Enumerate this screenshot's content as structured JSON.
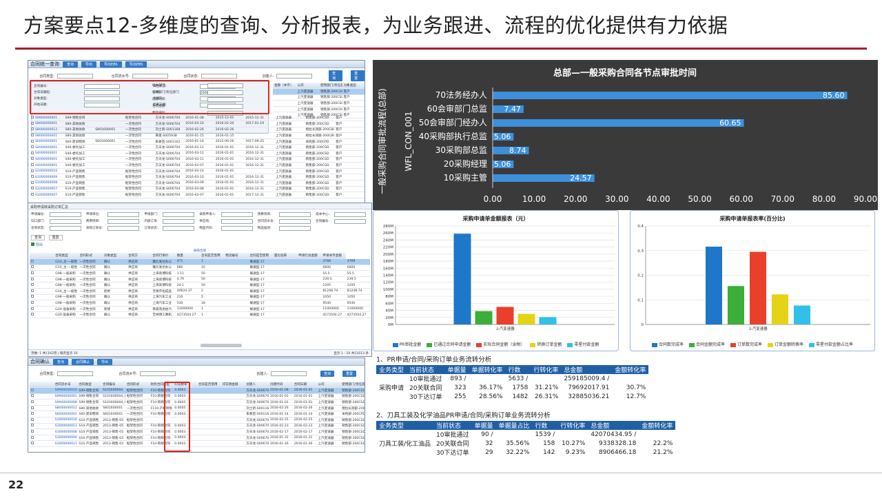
{
  "slide": {
    "title": "方案要点12-多维度的查询、分析报表，为业务跟进、流程的优化提供有力依据",
    "page_number": "22"
  },
  "shot1": {
    "title": "合同统一查询",
    "toolbar": [
      "查询",
      "导出",
      "导出EBS",
      "导出EBS"
    ],
    "filter_labels": [
      "合同类型:",
      "合同流水号:",
      "合同状态:",
      "创建人:"
    ],
    "filter_buttons": [
      "查询",
      "重置"
    ],
    "popup_fields": [
      "合同编号:",
      "归档状态:",
      "经办部门:",
      "合同日期起:",
      "合同日期起:",
      "公司:",
      "使用部门/责任部门:",
      "创建时间:",
      "对象类型:",
      "合同方:",
      "合同金额:",
      "开始日期:",
      "结束日期:",
      "物品编码:"
    ],
    "company_value": "200C-上汽变速器",
    "head_extra": [
      "金额（本币）",
      "公司",
      "使用部门/责任部门",
      "对象类型"
    ],
    "head_values": [
      [
        "上汽变速器",
        "销售部-200CSD",
        "客户"
      ],
      [
        "上汽变速器",
        "销售部-200CSD",
        "客户"
      ],
      [
        "上汽变速器",
        "销售部-200CSD",
        "客户"
      ],
      [
        "上汽变速器",
        "销售部-200CSD",
        "客户"
      ],
      [
        "上汽变速器",
        "销售部-200CSD",
        "客户"
      ]
    ],
    "rows": [
      [
        "S9900000001",
        "S99-销售合同",
        "",
        "框架性合同",
        "方天龙-S006704",
        "2016-01-08",
        "2015-12-01",
        "2015-12-31",
        "上汽变速器",
        "销售部-200CSD",
        "客户"
      ],
      [
        "S8000000001",
        "S80-其他收款",
        "",
        "一次性合同",
        "方天龙-S006704",
        "2016-03-10",
        "2016-02-20",
        "2017-01-19",
        "上汽变速器",
        "销售部-200CSD",
        "客户"
      ],
      [
        "S8000000012",
        "S80-其他收款",
        "S801600001",
        "一次性合同",
        "刘士新-S001168",
        "2016-02-26",
        "2016-02-26",
        "",
        "上汽变速器",
        "相拉长测部-200CBP",
        "客户"
      ],
      [
        "S8000000001",
        "S80-其他收款",
        "",
        "一次性合同",
        "黄俊-S005938",
        "2016-01-15",
        "2016-01-15",
        "",
        "上汽变速器",
        "相拉长测部-200CBP",
        "客户"
      ],
      [
        "S6000000001",
        "S60-废旧物资",
        "S601600001",
        "一次性合同",
        "朱春苗-S001162",
        "2016-01-14",
        "2015-09-26",
        "2017-09-25",
        "上汽变速器",
        "采购部-200CPD",
        "客户"
      ],
      [
        "S4000000001",
        "S40-委托加工",
        "",
        "一次性合同",
        "方天龙-S006704",
        "2016-03-11",
        "2016-01-01",
        "2016-12-31",
        "上汽变速器",
        "销售部-200CSD",
        "客户"
      ],
      [
        "S4000000001",
        "S40-委托加工",
        "",
        "一次性合同",
        "方天龙-S006704",
        "2016-03-11",
        "2016-01-01",
        "2016-12-31",
        "上汽变速器",
        "销售部-200CSD",
        "客户"
      ],
      [
        "S4000000001",
        "S40-委托加工",
        "",
        "一次性合同",
        "方天龙-S006704",
        "2016-03-11",
        "2016-01-01",
        "2016-12-31",
        "上汽变速器",
        "销售部-200CSD",
        "客户"
      ],
      [
        "S4000000001",
        "S40-委托加工",
        "",
        "一次性合同",
        "方天龙-S006704",
        "2016-03-07",
        "2016-01-01",
        "2016-12-31",
        "上汽变速器",
        "销售部-200CSD",
        "客户"
      ],
      [
        "S1000000010",
        "S10-产品销售",
        "",
        "框架性合同",
        "方天龙-S006704",
        "2016-03-14",
        "2016-01-01",
        "",
        "上汽变速器",
        "销售部-200CSD",
        "客户"
      ],
      [
        "S1000000009",
        "S10-产品销售",
        "",
        "框架性合同",
        "方天龙-S006704",
        "2016-03-10",
        "2016-01-01",
        "2016-12-31",
        "上汽变速器",
        "销售部-200CSD",
        "客户"
      ],
      [
        "S1000000008",
        "S10-产品销售",
        "",
        "框架性合同",
        "方天龙-S006704",
        "2016-03-09",
        "2016-01-01",
        "2016-12-31",
        "上汽变速器",
        "销售部-200CSD",
        "客户"
      ],
      [
        "S1000000007",
        "S10-产品销售",
        "",
        "框架性合同",
        "方天龙-S006704",
        "2016-03-08",
        "2016-01-01",
        "2016-12-31",
        "上汽变速器",
        "销售部-200CSD",
        "客户"
      ],
      [
        "S1000000007",
        "S10-产品销售",
        "",
        "框架性合同",
        "方天龙-S006704",
        "2016-03-07",
        "2016-01-01",
        "2017-12-31",
        "上汽变速器",
        "销售部-200CSD",
        "客户"
      ]
    ]
  },
  "shot2": {
    "title": "采购申请转采购订单汇总",
    "filter_labels": [
      "申请编号:",
      "申请单位:",
      "申请部门:",
      "采购申请人:",
      "预算项目:",
      "成本中心:",
      "归口部门:",
      "费用项目:",
      "内部订单:",
      "供应商:",
      "合同流水号:",
      "合同编号:",
      "合同状态:",
      "采购订单号:",
      "订单状态:",
      "物品代码:",
      "物品描述:"
    ],
    "buttons": [
      "查询",
      "重置"
    ],
    "export": "导出",
    "group_header": "采购合同",
    "headers": [
      "合同类型",
      "合同形式",
      "对象类型",
      "合同方",
      "合同行单价",
      "数量",
      "合同是否借用",
      "物流编号",
      "合同是否使用",
      "量比指率",
      "申请行总金额",
      "申请本币金额"
    ],
    "rows": [
      [
        "G10_主-一般性",
        "一次性合同",
        "确认",
        "供应商",
        "雅比发达办公",
        "471",
        "1",
        "",
        "联通型-17",
        "",
        "",
        "3768",
        "3768"
      ],
      [
        "G10_主-一般性",
        "一次性合同",
        "确认",
        "供应商",
        "雅比发达办公",
        "680",
        "10",
        "",
        "联通型-17",
        "",
        "",
        "6800",
        "6800"
      ],
      [
        "G98-一般采购",
        "一次性合同",
        "确认",
        "供应商",
        "上海高博科技",
        "1.11",
        "50",
        "",
        "联通型-17",
        "",
        "",
        "55.5",
        "55.5"
      ],
      [
        "G98-一般采购",
        "一次性合同",
        "确认",
        "供应商",
        "上海高博科技",
        "4.79",
        "50",
        "",
        "联通型-17",
        "",
        "",
        "239.5",
        "239.5"
      ],
      [
        "G98-一般采购",
        "一次性合同",
        "确认",
        "供应商",
        "上海高博科技",
        "24.1",
        "50",
        "",
        "联通型-17",
        "",
        "",
        "1205",
        "1205"
      ],
      [
        "G10_主-一般性",
        "一次性合同",
        "拒绝",
        "供应商",
        "无锡市恒成品",
        "40624.37",
        "2",
        "",
        "联通型-17",
        "",
        "",
        "81248.74",
        "81248.74"
      ],
      [
        "G98-一般采购",
        "一次性合同",
        "确认",
        "供应商",
        "上海汽车工业",
        "210",
        "5",
        "",
        "联通型-17",
        "",
        "",
        "1050",
        "1050"
      ],
      [
        "G98-一般采购",
        "一次性合同",
        "确认",
        "供应商",
        "上海汽车工业",
        "530",
        "18",
        "",
        "联通型-17",
        "",
        "",
        "9540",
        "9540"
      ],
      [
        "G20-设备采购",
        "一次性合同",
        "新建",
        "供应商",
        "蒂森克虏伯汽",
        "11000000",
        "1",
        "",
        "联通型-17",
        "",
        "",
        "11000000",
        "11000000"
      ],
      [
        "G20-设备采购",
        "一次性合同",
        "确认",
        "供应商",
        "吉林博工赛机",
        "4273504.27",
        "1",
        "",
        "联通型-17",
        "",
        "",
        "4273504.27",
        "4273504.27"
      ]
    ],
    "pager_left": "页数: 1 共1162页 | 每页显示 10",
    "pager_right": "显示 1 - 10 共11613 条"
  },
  "shot3": {
    "title": "合同确认",
    "toolbar": [
      "查询",
      "合同确认",
      "导出"
    ],
    "filter_labels": [
      "合同类型:",
      "合同流水号:",
      "创建人:"
    ],
    "buttons": [
      "查询",
      "重置"
    ],
    "headers": [
      "合同流水号",
      "合同类型",
      "合同编号",
      "合同形式",
      "财务合同类型",
      "印花税率",
      "合同是否借用",
      "印花税金额",
      "创建人",
      "创建时间",
      "合同日期",
      "公司",
      "使用部门/责任部门"
    ],
    "rows": [
      [
        "S9900000010",
        "S99-销售合同",
        "S101600004",
        "框架性合同",
        "F10-购销合同",
        "0.0003",
        "",
        "",
        "方天龙-S006704",
        "2016-01-08",
        "2016-01-01",
        "上汽变速器",
        "销售部-200CSD"
      ],
      [
        "S9900000001",
        "S99-销售合同",
        "S101600004_01",
        "框架性合同",
        "F10-购销合同",
        "0.0003",
        "",
        "",
        "方天龙-S006704",
        "2016-01-01",
        "2016-01-01",
        "上汽变速器",
        "销售部-200CSD"
      ],
      [
        "S9900000008",
        "S99-销售合同",
        "S101600004_01",
        "框架性合同",
        "F10-购销合同",
        "0.0003",
        "",
        "",
        "方天龙-S006704",
        "2016-01-01",
        "2016-01-01",
        "上汽变速器",
        "销售部-200CSD"
      ],
      [
        "S8000000012",
        "S80-其他收款",
        "S801600001",
        "一次性合同",
        "F110-产权转移",
        "0.0005",
        "",
        "",
        "刘士新-S001168",
        "2016-02-26",
        "2016-02-26",
        "上汽变速器",
        "相拉长测部-200CBP"
      ],
      [
        "S6000000001",
        "S60-废旧物资",
        "S601600001",
        "一次性合同",
        "F10-购销合同",
        "0.0003",
        "",
        "",
        "朱春苗-S001162",
        "2016-01-14",
        "2016-01-14",
        "上汽变速器",
        "采购部-200CPD"
      ],
      [
        "S1000000016",
        "S10-产品销售",
        "2013-销售-05",
        "框架性合同",
        "",
        "",
        "",
        "",
        "方天龙-S006704",
        "2016-02-25",
        "2016-02-25",
        "上汽变速器",
        "销售部-200CSD"
      ],
      [
        "S1000000013",
        "S10-产品销售",
        "2013-销售-05",
        "框架性合同",
        "F10-购销合同",
        "0.0003",
        "",
        "",
        "方天龙-S006704",
        "2016-02-23",
        "2016-02-23",
        "上汽变速器",
        "销售部-200CSD"
      ],
      [
        "S1000000008",
        "S10-产品销售",
        "2013-销售-05",
        "框架性合同",
        "F10-购销合同",
        "0.0003",
        "",
        "",
        "方天龙-S006704",
        "2016-02-17",
        "2016-02-17",
        "上汽变速器",
        "销售部-200CSD"
      ],
      [
        "S1000000004",
        "S10-产品销售",
        "2013-销售-02",
        "框架性合同",
        "F10-购销合同",
        "0.0003",
        "",
        "",
        "方天龙-S006704",
        "2016-01-31",
        "2016-01-31",
        "上汽变速器",
        "销售部-200CSD"
      ],
      [
        "S1000000017",
        "S10-产品销售",
        "2013-销售-02",
        "框架性合同",
        "F10-购销合同",
        "0.0003",
        "",
        "",
        "方天龙-S006704",
        "2016-01-26",
        "2016-01-26",
        "上汽变速器",
        "销售部-200CSD"
      ]
    ]
  },
  "chart_data": [
    {
      "type": "bar",
      "orientation": "horizontal",
      "title": "总部—一般采购合同各节点审批时间",
      "ylabel": "一般采购合同审批流程(总部) WFL_CON_001",
      "categories": [
        "70法务经办人",
        "60会审部门总监",
        "50会审部门经办人",
        "40采购部执行总监",
        "30采购部总监",
        "20采购经理",
        "10采购主管"
      ],
      "values": [
        85.6,
        7.47,
        60.65,
        5.06,
        8.74,
        5.06,
        24.57
      ],
      "value_labels": [
        "85.60",
        "7.47",
        "60.65",
        "5.06",
        "8.74",
        "5.06",
        "24.57"
      ],
      "xlim": [
        0,
        90
      ],
      "xticks": [
        "0.00",
        "10.00",
        "20.00",
        "30.00",
        "40.00",
        "50.00",
        "60.00",
        "70.00",
        "80.00",
        "90.00"
      ],
      "colors": {
        "bg": "#3a3a3a",
        "bar": "#3d8fdc",
        "text": "#ffffff"
      }
    },
    {
      "type": "bar",
      "title": "采购申请单金额报表（元）",
      "categories": [
        "上汽变速器"
      ],
      "series": [
        {
          "name": "PR审批金额",
          "values": [
            258000000
          ],
          "color": "#1f77c9"
        },
        {
          "name": "已通过合同申请金额",
          "values": [
            38000000
          ],
          "color": "#3cae3a"
        },
        {
          "name": "实际合同金额（含税）",
          "values": [
            50000000
          ],
          "color": "#e8402a"
        },
        {
          "name": "转换订单金额",
          "values": [
            30000000
          ],
          "color": "#e3d415"
        },
        {
          "name": "零星付款金额",
          "values": [
            21000000
          ],
          "color": "#31c0e8"
        }
      ],
      "ylim": [
        0,
        280000000
      ],
      "yticks": [
        "0M",
        "20M",
        "40M",
        "60M",
        "80M",
        "100M",
        "120M",
        "140M",
        "160M",
        "180M",
        "200M",
        "220M",
        "240M",
        "260M",
        "280M"
      ]
    },
    {
      "type": "bar",
      "title": "采购申请单报表率(百分比)",
      "categories": [
        "上汽变速器"
      ],
      "series": [
        {
          "name": "合同数完成率",
          "values": [
            0.316
          ],
          "color": "#1f77c9"
        },
        {
          "name": "合同金额完成率",
          "values": [
            0.156
          ],
          "color": "#3cae3a"
        },
        {
          "name": "订单数完成率",
          "values": [
            0.295
          ],
          "color": "#e8402a"
        },
        {
          "name": "订单金额转换率",
          "values": [
            0.122
          ],
          "color": "#e3d415"
        },
        {
          "name": "零星付款金额占比率",
          "values": [
            0.077
          ],
          "color": "#31c0e8"
        }
      ],
      "ylim": [
        0,
        0.4
      ],
      "yticks": [
        "0",
        "0.1",
        "0.2",
        "0.3",
        "0.4"
      ]
    }
  ],
  "stats1": {
    "caption": "1、PR申请/合同/采购订单业务流转分析",
    "headers": [
      "业务类型",
      "当前状态",
      "单据量",
      "单据转化率",
      "行数",
      "行转化率",
      "总金额",
      "金额转化率"
    ],
    "type": "采购申请",
    "rows": [
      [
        "10审批通过",
        "893 /",
        "",
        "5633 /",
        "",
        "259185009.4 /",
        ""
      ],
      [
        "20关联合同",
        "323",
        "36.17%",
        "1758",
        "31.21%",
        "79692017.91",
        "30.7%"
      ],
      [
        "30下达订单",
        "255",
        "28.56%",
        "1482",
        "26.31%",
        "32885036.21",
        "12.7%"
      ]
    ]
  },
  "stats2": {
    "caption": "2、刀具工装及化学油品PR申请/合同/采购订单业务流转分析",
    "headers": [
      "业务类型",
      "当前状态",
      "单据量",
      "单据量占比",
      "行数",
      "行转化率",
      "总金额",
      "金额转化率"
    ],
    "type": "刀具工装/化工油品",
    "rows": [
      [
        "10审批通过",
        "90 /",
        "",
        "1539 /",
        "",
        "42070434.95 /",
        ""
      ],
      [
        "20关联合同",
        "32",
        "35.56%",
        "158",
        "10.27%",
        "9338328.18",
        "22.2%"
      ],
      [
        "30下达订单",
        "29",
        "32.22%",
        "142",
        "9.23%",
        "8906466.18",
        "21.2%"
      ]
    ]
  }
}
